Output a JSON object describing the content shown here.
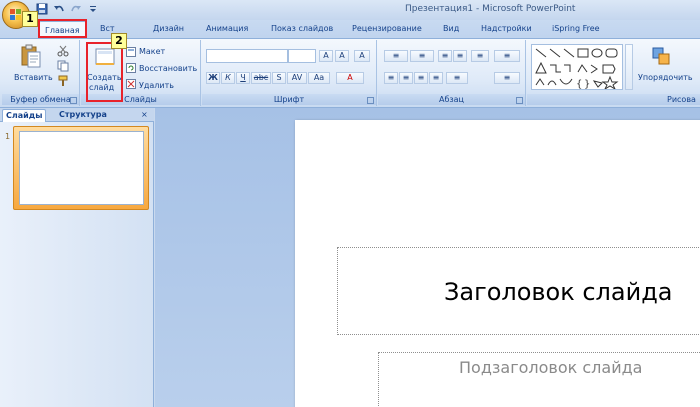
{
  "window": {
    "title": "Презентация1 - Microsoft PowerPoint",
    "qat_icons": [
      "save-icon",
      "undo-icon",
      "redo-icon",
      "customize-icon"
    ]
  },
  "tabs": [
    {
      "id": "home",
      "label": "Главная",
      "active": true
    },
    {
      "id": "insert",
      "label": "Вставка",
      "visible_label": "Вст"
    },
    {
      "id": "design",
      "label": "Дизайн"
    },
    {
      "id": "animation",
      "label": "Анимация"
    },
    {
      "id": "slideshow",
      "label": "Показ слайдов"
    },
    {
      "id": "review",
      "label": "Рецензирование"
    },
    {
      "id": "view",
      "label": "Вид"
    },
    {
      "id": "settings",
      "label": "Надстройки"
    },
    {
      "id": "ispring",
      "label": "iSpring Free"
    }
  ],
  "ribbon": {
    "clipboard": {
      "label": "Буфер обмена",
      "paste": "Вставить"
    },
    "slides": {
      "label": "Слайды",
      "new_slide_line1": "Создать",
      "new_slide_line2": "слайд",
      "layout": "Макет",
      "reset": "Восстановить",
      "delete": "Удалить"
    },
    "font": {
      "label": "Шрифт",
      "bold": "Ж",
      "italic": "К",
      "underline": "Ч",
      "strike": "abc",
      "shadow": "S",
      "spacing": "AV",
      "case": "Aa"
    },
    "paragraph": {
      "label": "Абзац"
    },
    "drawing": {
      "label": "Рисова",
      "arrange": "Упорядочить"
    }
  },
  "left_pane": {
    "tabs": [
      "Слайды",
      "Структура"
    ],
    "close": "×",
    "slide_number": "1"
  },
  "slide": {
    "title_placeholder": "Заголовок слайда",
    "subtitle_placeholder": "Подзаголовок слайда"
  },
  "callouts": [
    "1",
    "2"
  ],
  "colors": {
    "highlight": "#e8222a",
    "badge": "#ffff9a",
    "accent": "#15428b"
  }
}
